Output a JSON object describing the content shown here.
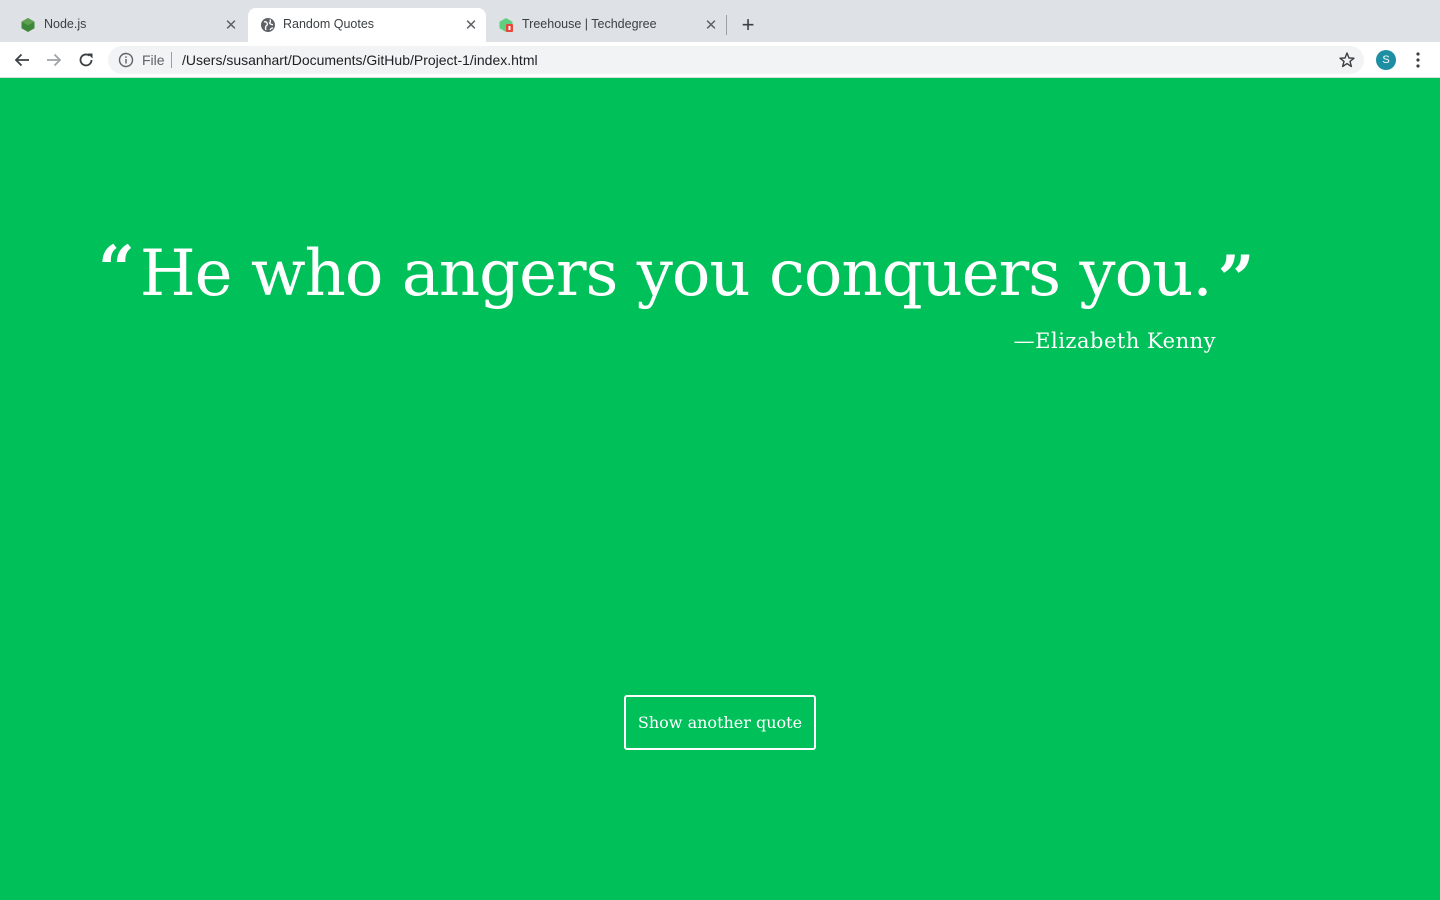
{
  "browser": {
    "tabs": [
      {
        "label": "Node.js",
        "icon": "nodejs-icon",
        "active": false
      },
      {
        "label": "Random Quotes",
        "icon": "globe-icon",
        "active": true
      },
      {
        "label": "Treehouse | Techdegree",
        "icon": "treehouse-icon",
        "active": false
      }
    ],
    "close_glyph": "✕",
    "new_tab_glyph": "+",
    "address": {
      "scheme": "File",
      "url": "/Users/susanhart/Documents/GitHub/Project-1/index.html"
    },
    "profile_initial": "S",
    "colors": {
      "tabstrip": "#dee1e6",
      "avatar": "#1e8fa3"
    }
  },
  "page": {
    "background_color": "#00c05a",
    "quote": {
      "open_mark": "“",
      "text": "He who angers you conquers you.",
      "close_mark": "”"
    },
    "attribution": "—Elizabeth Kenny",
    "button_label": "Show another quote"
  }
}
